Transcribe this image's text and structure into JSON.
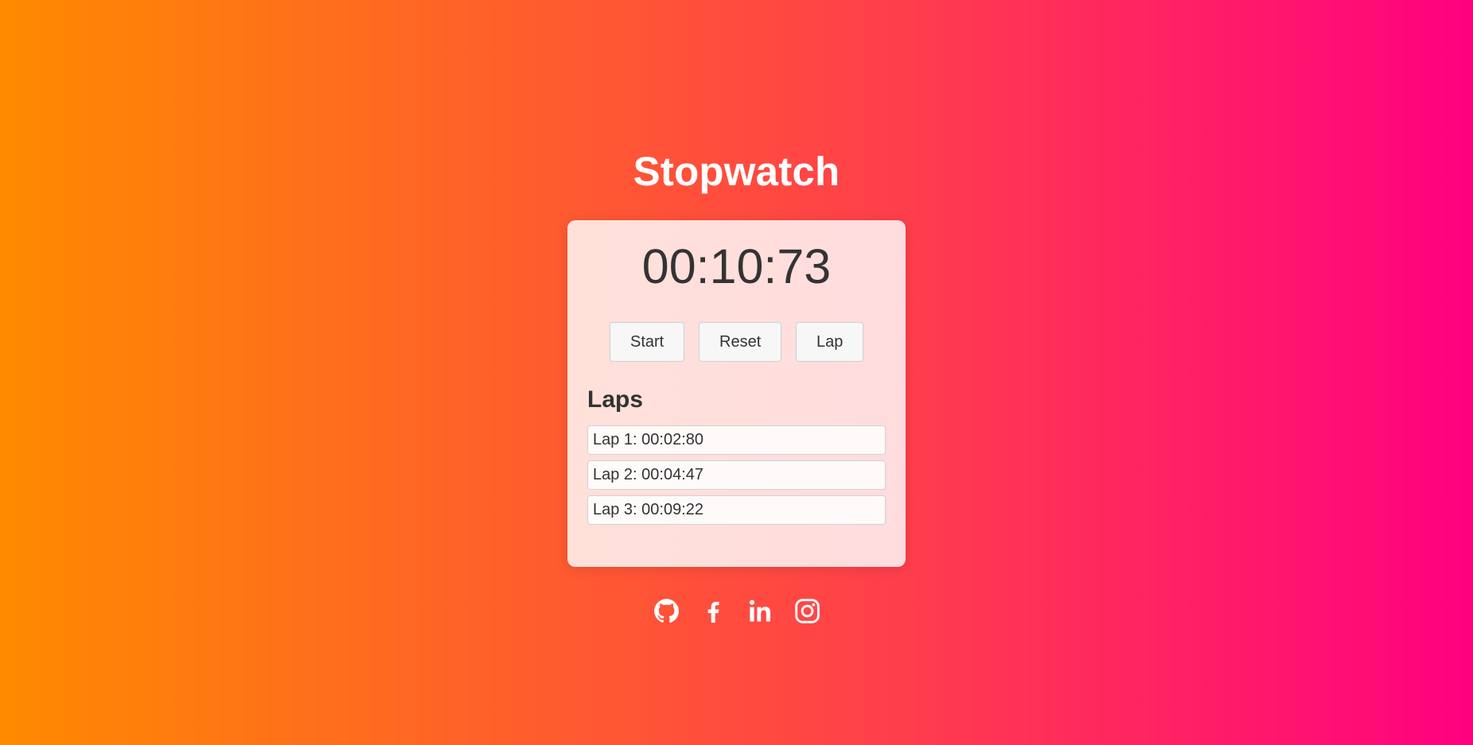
{
  "page": {
    "title": "Stopwatch"
  },
  "stopwatch": {
    "time": "00:10:73",
    "buttons": {
      "start": "Start",
      "reset": "Reset",
      "lap": "Lap"
    }
  },
  "laps": {
    "heading": "Laps",
    "items": [
      "Lap 1: 00:02:80",
      "Lap 2: 00:04:47",
      "Lap 3: 00:09:22"
    ]
  },
  "social": {
    "icons": [
      "github-icon",
      "facebook-icon",
      "linkedin-icon",
      "instagram-icon"
    ]
  },
  "colors": {
    "gradient_start": "#ff8a00",
    "gradient_mid": "#ff3d4d",
    "gradient_end": "#ff007f",
    "text_dark": "#333333"
  }
}
